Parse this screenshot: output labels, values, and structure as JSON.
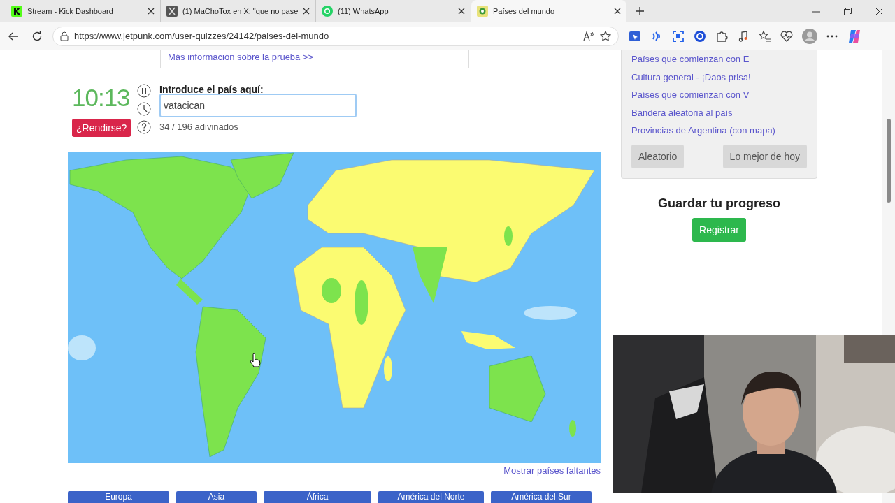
{
  "browser": {
    "tabs": [
      {
        "title": "Stream - Kick Dashboard",
        "selected": false
      },
      {
        "title": "(1) MaChoTox en X: \"que no pase",
        "selected": false
      },
      {
        "title": "(11) WhatsApp",
        "selected": false
      },
      {
        "title": "Países del mundo",
        "selected": true
      }
    ],
    "url": "https://www.jetpunk.com/user-quizzes/24142/paises-del-mundo"
  },
  "quiz": {
    "info_link": "Más información sobre la prueba >>",
    "timer": "10:13",
    "give_up": "¿Rendirse?",
    "input_label": "Introduce el país aquí:",
    "input_value": "vatacican",
    "progress": "34 / 196 adivinados",
    "show_missing": "Mostrar países faltantes",
    "region_buttons": [
      "Europa",
      "Asia",
      "África",
      "América del Norte",
      "América del Sur"
    ]
  },
  "sidebar": {
    "links": [
      "Países que comienzan con E",
      "Cultura general - ¡Daos prisa!",
      "Países que comienzan con V",
      "Bandera aleatoria al país",
      "Provincias de Argentina (con mapa)"
    ],
    "buttons": [
      "Aleatorio",
      "Lo mejor de hoy"
    ],
    "save_heading": "Guardar tu progreso",
    "register": "Registrar"
  }
}
